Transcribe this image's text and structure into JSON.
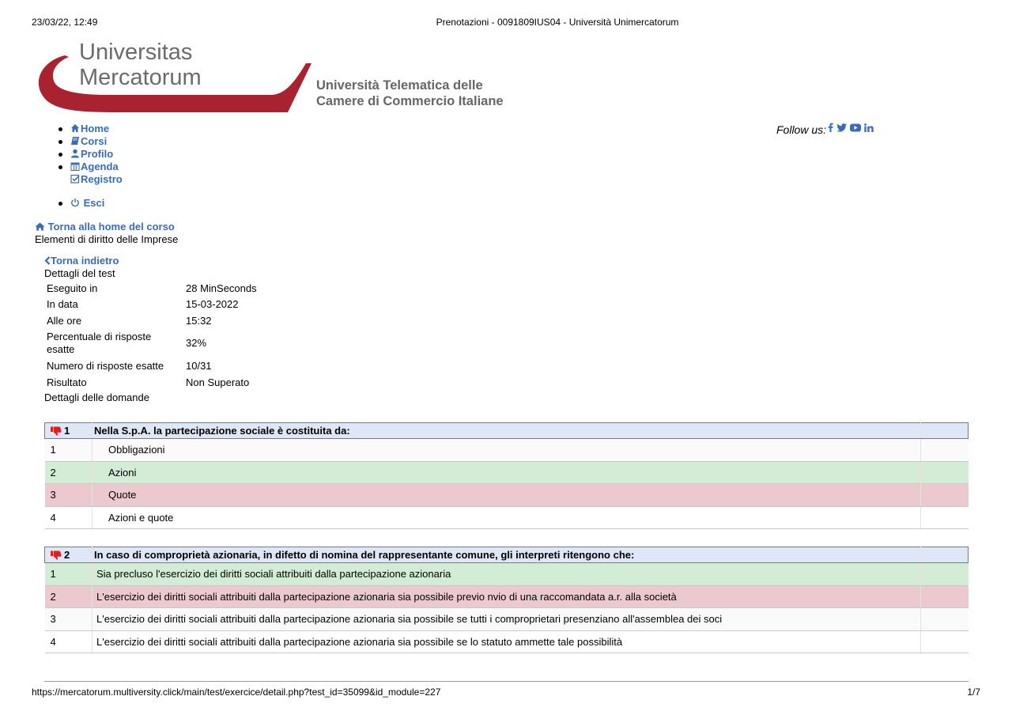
{
  "print_header": {
    "datetime": "23/03/22, 12:49",
    "title": "Prenotazioni - 0091809IUS04 - Università Unimercatorum"
  },
  "logo": {
    "line1": "Universitas",
    "line2": "Mercatorum",
    "sub1": "Università Telematica delle",
    "sub2": "Camere di Commercio Italiane",
    "brand_red": "#a8232f",
    "brand_gray": "#6b6b6b"
  },
  "nav": {
    "home": "Home",
    "corsi": "Corsi",
    "profilo": "Profilo",
    "agenda": "Agenda",
    "registro": "Registro",
    "esci": "Esci",
    "link_color": "#3a6cb4"
  },
  "follow": {
    "label": "Follow us:",
    "icons": [
      "facebook-icon",
      "twitter-icon",
      "youtube-icon",
      "linkedin-icon"
    ]
  },
  "course": {
    "back_home": "Torna alla home del corso",
    "name": "Elementi di diritto delle Imprese",
    "back": "Torna indietro",
    "test_details_title": "Dettagli del test",
    "questions_title": "Dettagli delle domande"
  },
  "details": [
    {
      "label": "Eseguito in",
      "value": "28 MinSeconds"
    },
    {
      "label": "In data",
      "value": "15-03-2022"
    },
    {
      "label": "Alle ore",
      "value": "15:32"
    },
    {
      "label": "Percentuale di risposte esatte",
      "value": "32%"
    },
    {
      "label": "Numero di risposte esatte",
      "value": "10/31"
    },
    {
      "label": "Risultato",
      "value": "Non Superato"
    }
  ],
  "questions": [
    {
      "number": "1",
      "text": "Nella S.p.A. la partecipazione sociale è costituita da:",
      "answers": [
        {
          "n": "1",
          "text": "Obbligazioni",
          "state": "light"
        },
        {
          "n": "2",
          "text": "Azioni",
          "state": "green"
        },
        {
          "n": "3",
          "text": "Quote",
          "state": "red"
        },
        {
          "n": "4",
          "text": "Azioni e quote",
          "state": "plain"
        }
      ]
    },
    {
      "number": "2",
      "text": "In caso di comproprietà azionaria, in difetto di nomina del rappresentante comune, gli interpreti ritengono che:",
      "answers": [
        {
          "n": "1",
          "text": "Sia precluso l'esercizio dei diritti sociali attribuiti dalla partecipazione azionaria",
          "state": "green"
        },
        {
          "n": "2",
          "text": "L'esercizio dei diritti sociali attribuiti dalla partecipazione azionaria sia possibile previo nvio di una raccomandata a.r. alla società",
          "state": "red"
        },
        {
          "n": "3",
          "text": "L'esercizio dei diritti sociali attribuiti dalla partecipazione azionaria sia possibile se tutti i comproprietari presenziano all'assemblea dei soci",
          "state": "light"
        },
        {
          "n": "4",
          "text": "L'esercizio dei diritti sociali attribuiti dalla partecipazione azionaria sia possibile se lo statuto ammette tale possibilità",
          "state": "plain"
        }
      ]
    }
  ],
  "print_footer": {
    "url": "https://mercatorum.multiversity.click/main/test/exercice/detail.php?test_id=35099&id_module=227",
    "page": "1/7"
  },
  "colors": {
    "header_row": "#dde7f5",
    "correct_row": "#d3ecd5",
    "wrong_row": "#ebc9cf",
    "thumb_red": "#e0201c"
  }
}
